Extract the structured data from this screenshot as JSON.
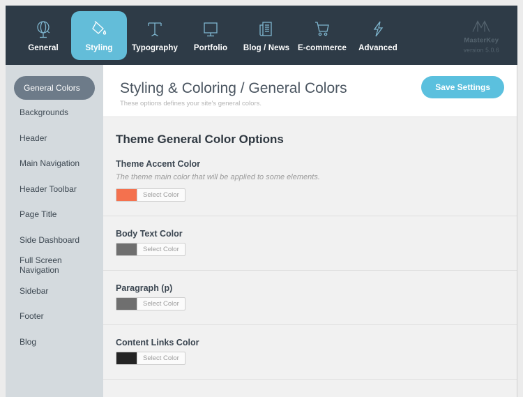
{
  "topnav": {
    "items": [
      {
        "label": "General",
        "icon": "globe-icon",
        "active": false
      },
      {
        "label": "Styling",
        "icon": "paint-bucket-icon",
        "active": true
      },
      {
        "label": "Typography",
        "icon": "text-t-icon",
        "active": false
      },
      {
        "label": "Portfolio",
        "icon": "monitor-icon",
        "active": false
      },
      {
        "label": "Blog / News",
        "icon": "newspaper-icon",
        "active": false
      },
      {
        "label": "E-commerce",
        "icon": "shopping-cart-icon",
        "active": false
      },
      {
        "label": "Advanced",
        "icon": "lightning-bolt-icon",
        "active": false
      }
    ],
    "brand": {
      "icon": "masterkey-logo-icon",
      "name": "MasterKey",
      "version": "version 5.0.6"
    },
    "bg_color": "#2e3b47",
    "active_color": "#63bdd9"
  },
  "sidebar": {
    "items": [
      {
        "label": "General Colors",
        "active": true
      },
      {
        "label": "Backgrounds",
        "active": false
      },
      {
        "label": "Header",
        "active": false
      },
      {
        "label": "Main Navigation",
        "active": false
      },
      {
        "label": "Header Toolbar",
        "active": false
      },
      {
        "label": "Page Title",
        "active": false
      },
      {
        "label": "Side Dashboard",
        "active": false
      },
      {
        "label": "Full Screen Navigation",
        "active": false
      },
      {
        "label": "Sidebar",
        "active": false
      },
      {
        "label": "Footer",
        "active": false
      },
      {
        "label": "Blog",
        "active": false
      }
    ],
    "bg_color": "#d4dade",
    "active_bg_color": "#6d7b89"
  },
  "header": {
    "title": "Styling & Coloring / General Colors",
    "subtitle": "These options defines your site's general colors.",
    "save_label": "Save Settings",
    "save_color": "#5bc0de"
  },
  "main": {
    "section_title": "Theme General Color Options",
    "options": [
      {
        "label": "Theme Accent Color",
        "description": "The theme main color that will be applied to some elements.",
        "button_label": "Select Color",
        "swatch_color": "#f4714e"
      },
      {
        "label": "Body Text Color",
        "description": "",
        "button_label": "Select Color",
        "swatch_color": "#6f6f6f"
      },
      {
        "label": "Paragraph (p)",
        "description": "",
        "button_label": "Select Color",
        "swatch_color": "#6f6f6f"
      },
      {
        "label": "Content Links Color",
        "description": "",
        "button_label": "Select Color",
        "swatch_color": "#242424"
      }
    ]
  }
}
